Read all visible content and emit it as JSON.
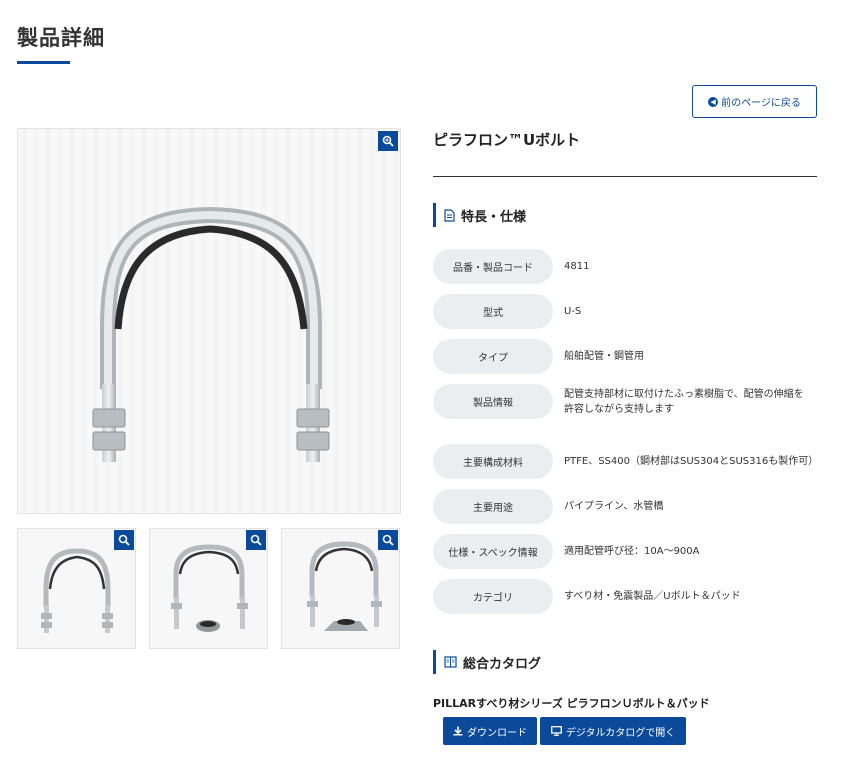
{
  "header": {
    "title": "製品詳細"
  },
  "back_button": {
    "label": "前のページに戻る",
    "icon": "arrow-left-circle-icon"
  },
  "gallery": {
    "zoom_icon": "zoom-in-icon",
    "thumbnails": [
      "u-bolt",
      "u-bolt-with-pad",
      "u-bolt-with-pad-alt"
    ]
  },
  "product": {
    "name": "ピラフロン™Uボルト"
  },
  "features": {
    "heading": "特長・仕様",
    "icon": "document-icon",
    "rows": [
      {
        "label": "品番・製品コード",
        "value": "4811"
      },
      {
        "label": "型式",
        "value": "U-S"
      },
      {
        "label": "タイプ",
        "value": "船舶配管・鋼管用"
      },
      {
        "label": "製品情報",
        "value": "配管支持部材に取付けたふっ素樹脂で、配管の伸縮を許容しながら支持します"
      },
      {
        "label": "主要構成材料",
        "value": "PTFE、SS400（鋼材部はSUS304とSUS316も製作可）"
      },
      {
        "label": "主要用途",
        "value": "パイプライン、水管橋"
      },
      {
        "label": "仕様・スペック情報",
        "value": "適用配管呼び径：10A〜900A"
      },
      {
        "label": "カテゴリ",
        "value": "すべり材・免震製品／Uボルト＆パッド"
      }
    ]
  },
  "catalog": {
    "heading": "総合カタログ",
    "icon": "book-icon",
    "name": "PILLARすべり材シリーズ ピラフロンＵボルト＆パッド",
    "download_label": "ダウンロード",
    "digital_label": "デジタルカタログで開く"
  },
  "colors": {
    "accent": "#0b4a9b",
    "label_bg": "#ebeef0"
  }
}
